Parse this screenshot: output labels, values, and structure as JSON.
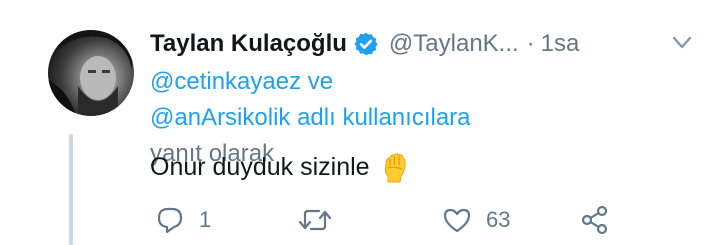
{
  "tweet": {
    "author": {
      "name": "Taylan Kulaçoğlu",
      "handle": "@TaylanK...",
      "verified_icon": "verified-badge-icon",
      "verified_color": "#1da1f2"
    },
    "separator": "·",
    "time": "1sa",
    "reply_to": {
      "mention_1": "@cetinkayaez",
      "conjunction": "ve",
      "mention_2": "@anArsikolik",
      "text_blue": "adlı kullanıcılara",
      "text_gray": "yanıt olarak"
    },
    "text": "Onur duyduk sizinle",
    "emoji_icon": "raised-fist-icon",
    "actions": {
      "reply": {
        "icon": "reply-icon",
        "count": "1"
      },
      "retweet": {
        "icon": "retweet-icon",
        "count": ""
      },
      "like": {
        "icon": "heart-icon",
        "count": "63"
      },
      "share": {
        "icon": "share-icon",
        "count": ""
      }
    }
  },
  "colors": {
    "link": "#1da1f2",
    "secondary_text": "#657786",
    "primary_text": "#14171a",
    "thread_line": "#ccd6dd"
  }
}
